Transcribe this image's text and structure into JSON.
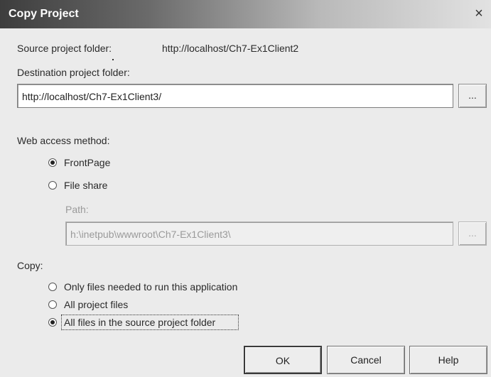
{
  "dialog": {
    "title": "Copy Project",
    "close_glyph": "×"
  },
  "source": {
    "label": "Source project folder:",
    "value": "http://localhost/Ch7-Ex1Client2"
  },
  "destination": {
    "label": "Destination project folder:",
    "value": "http://localhost/Ch7-Ex1Client3/",
    "browse_label": "..."
  },
  "web_access": {
    "label": "Web access method:",
    "options": [
      {
        "label": "FrontPage",
        "selected": true
      },
      {
        "label": "File share",
        "selected": false
      }
    ],
    "path_label": "Path:",
    "path_value": "h:\\inetpub\\wwwroot\\Ch7-Ex1Client3\\",
    "path_browse_label": "..."
  },
  "copy": {
    "label": "Copy:",
    "options": [
      {
        "label": "Only files needed to run this application",
        "selected": false
      },
      {
        "label": "All project files",
        "selected": false
      },
      {
        "label": "All files in the source project folder",
        "selected": true
      }
    ]
  },
  "buttons": {
    "ok": "OK",
    "cancel": "Cancel",
    "help": "Help"
  }
}
